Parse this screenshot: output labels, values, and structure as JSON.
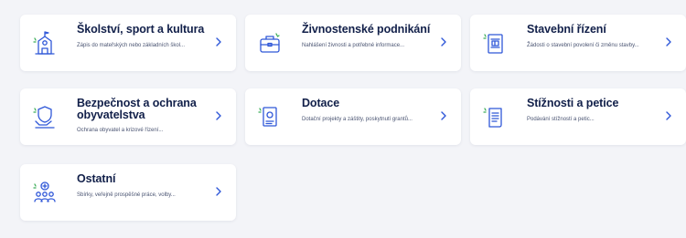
{
  "colors": {
    "accent": "#2f57d8",
    "title": "#12204a",
    "icon_green": "#3fae5a",
    "background": "#f3f4f8"
  },
  "cards": [
    {
      "title": "Školství, sport a kultura",
      "description": "Zápis do mateřských nebo základních škol...",
      "icon": "school-building-icon"
    },
    {
      "title": "Živnostenské podnikání",
      "description": "Nahlášení živnosti a potřebné informace...",
      "icon": "briefcase-icon"
    },
    {
      "title": "Stavební řízení",
      "description": "Žádosti o stavební povolení či změnu stavby...",
      "icon": "blueprint-document-icon"
    },
    {
      "title": "Bezpečnost a ochrana obyvatelstva",
      "description": "Ochrana obyvatel a krizové řízení...",
      "icon": "shield-hand-icon"
    },
    {
      "title": "Dotace",
      "description": "Dotační projekty a záštity, poskytnutí grantů...",
      "icon": "grant-document-icon"
    },
    {
      "title": "Stížnosti a petice",
      "description": "Podávání stížností a petic...",
      "icon": "petition-scroll-icon"
    },
    {
      "title": "Ostatní",
      "description": "Sbírky, veřejně prospěšné práce, volby...",
      "icon": "people-group-icon"
    }
  ]
}
